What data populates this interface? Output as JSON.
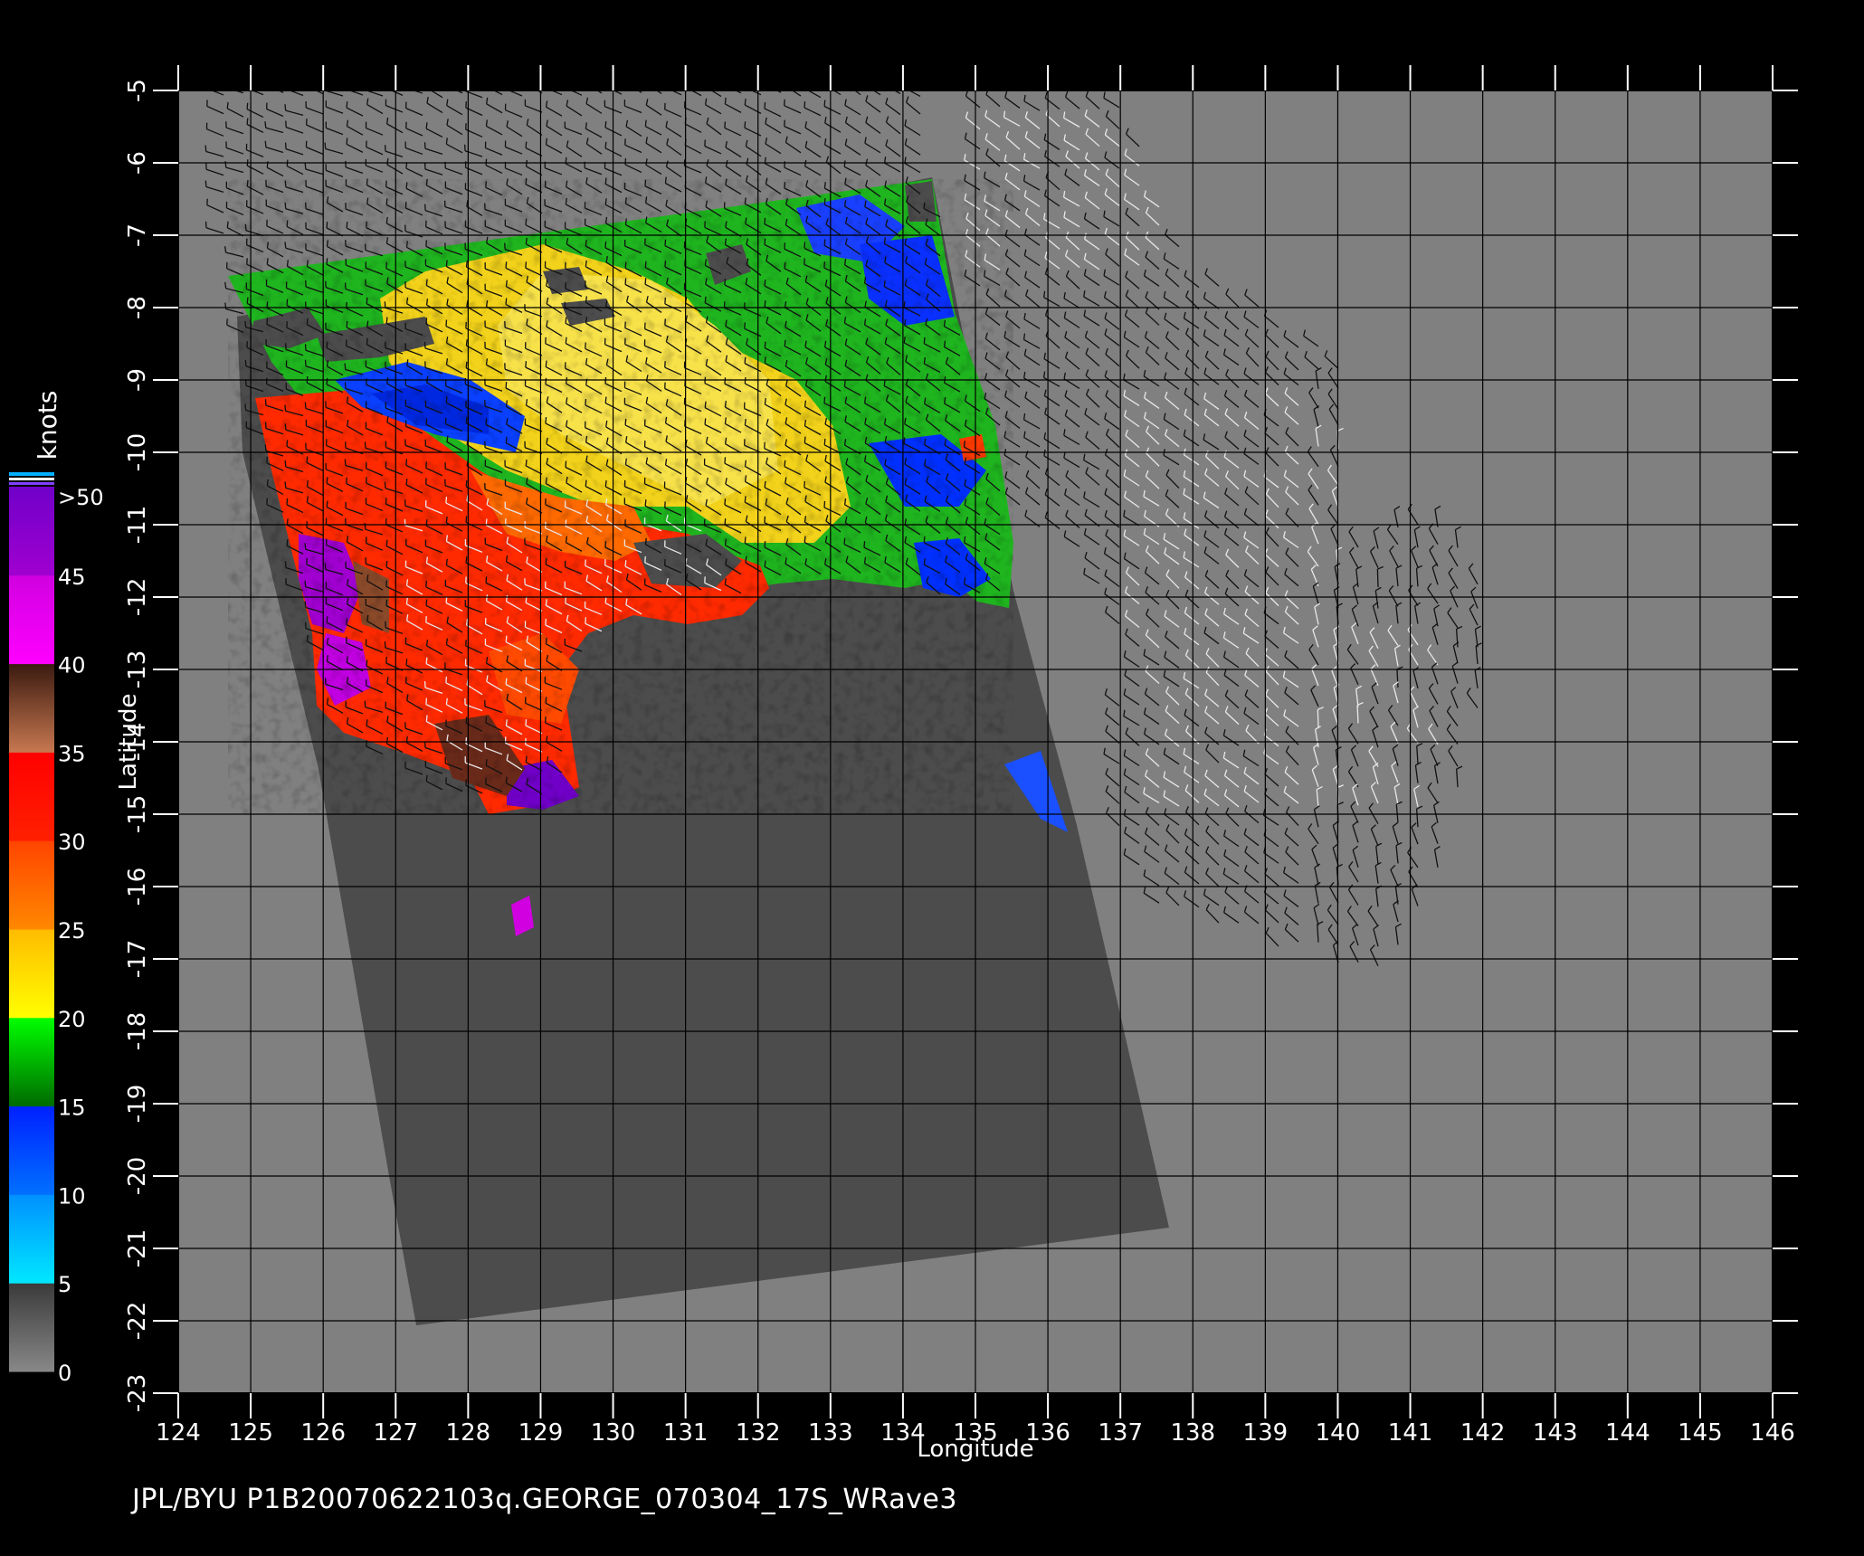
{
  "caption": "JPL/BYU  P1B20070622103q.GEORGE_070304_17S_WRave3",
  "x_axis": {
    "label": "Longitude",
    "ticks": [
      "124",
      "125",
      "126",
      "127",
      "128",
      "129",
      "130",
      "131",
      "132",
      "133",
      "134",
      "135",
      "136",
      "137",
      "138",
      "139",
      "140",
      "141",
      "142",
      "143",
      "144",
      "145",
      "146"
    ]
  },
  "y_axis": {
    "label": "Latitude",
    "ticks": [
      "-5",
      "-6",
      "-7",
      "-8",
      "-9",
      "-10",
      "-11",
      "-12",
      "-13",
      "-14",
      "-15",
      "-16",
      "-17",
      "-18",
      "-19",
      "-20",
      "-21",
      "-22",
      "-23"
    ]
  },
  "colorbar": {
    "title": "knots",
    "labels": [
      ">50",
      "45",
      "40",
      "35",
      "30",
      "25",
      "20",
      "15",
      "10",
      "5",
      "0"
    ],
    "segments": [
      {
        "from": 0,
        "to": 5,
        "colors": [
          "#888888",
          "#3a3a3a"
        ]
      },
      {
        "from": 5,
        "to": 10,
        "colors": [
          "#00e8ff",
          "#0090ff"
        ]
      },
      {
        "from": 10,
        "to": 15,
        "colors": [
          "#0070ff",
          "#0020ff"
        ]
      },
      {
        "from": 15,
        "to": 20,
        "colors": [
          "#006a00",
          "#00ff00"
        ]
      },
      {
        "from": 20,
        "to": 25,
        "colors": [
          "#ffff00",
          "#ffbb00"
        ]
      },
      {
        "from": 25,
        "to": 30,
        "colors": [
          "#ff8800",
          "#ff4400"
        ]
      },
      {
        "from": 30,
        "to": 35,
        "colors": [
          "#ff2000",
          "#ff0000"
        ]
      },
      {
        "from": 35,
        "to": 40,
        "colors": [
          "#c87850",
          "#3a1a10"
        ]
      },
      {
        "from": 40,
        "to": 45,
        "colors": [
          "#ff00ff",
          "#d000e0"
        ]
      },
      {
        "from": 45,
        "to": 50,
        "colors": [
          "#a000d0",
          "#7000c8"
        ]
      }
    ]
  },
  "colors": {
    "background": "#000000",
    "map_background": "#808080",
    "swath": "#4c4c4c",
    "grid": "#000000",
    "text": "#ffffff"
  }
}
